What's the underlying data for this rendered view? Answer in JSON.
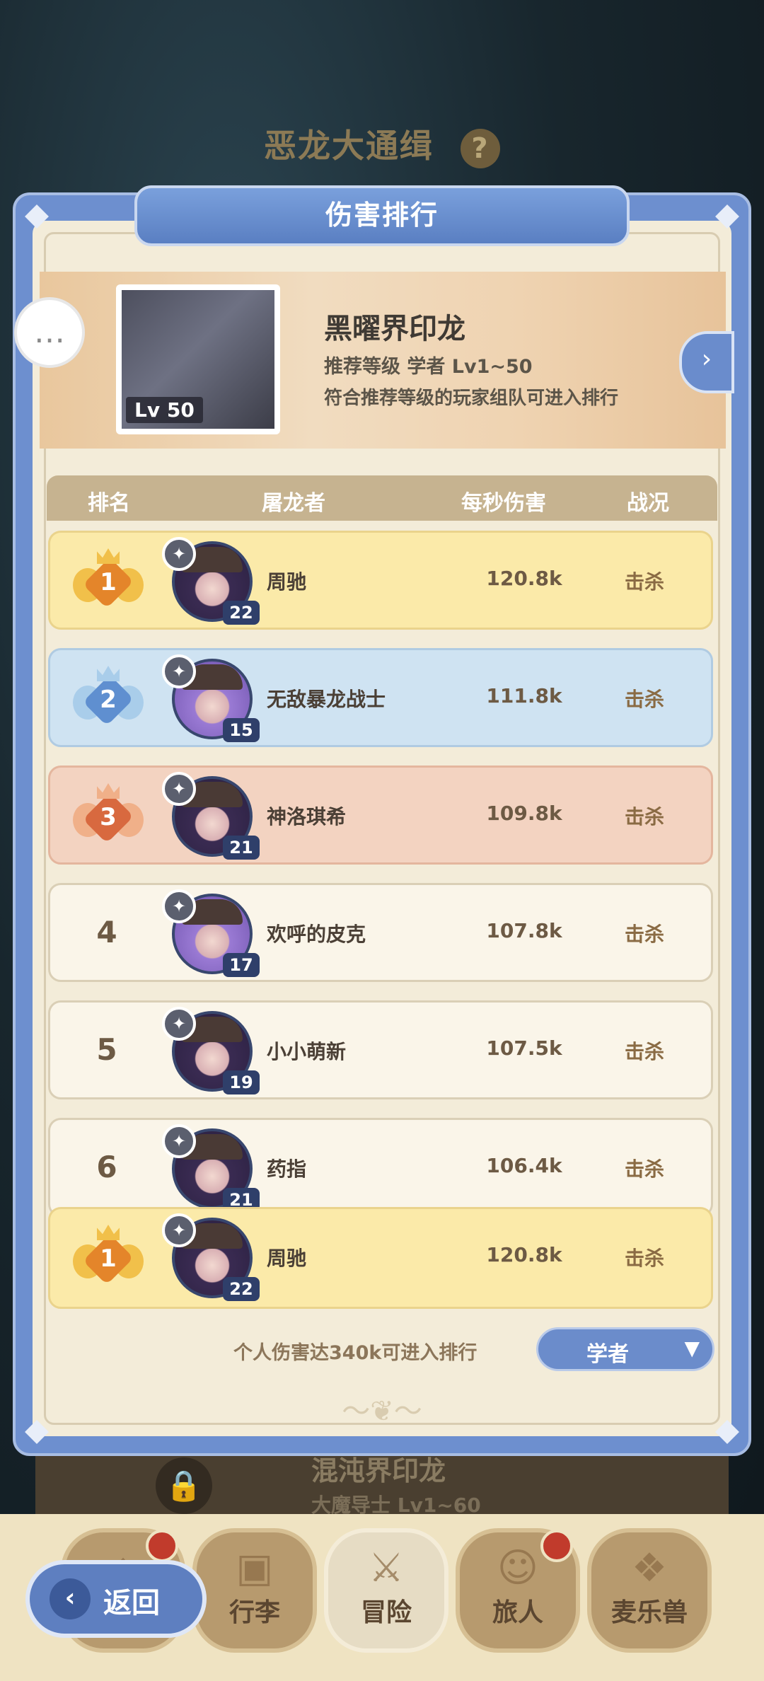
{
  "background": {
    "title": "恶龙大通缉",
    "help": "?",
    "card_title": "混沌界印龙",
    "card_sub": "大魔导士  Lv1~60"
  },
  "modal": {
    "title": "伤害排行",
    "boss": {
      "level": "Lv  50",
      "name": "黑曜界印龙",
      "recommend": "推荐等级  学者  Lv1~50",
      "note": "符合推荐等级的玩家组队可进入排行"
    },
    "headers": {
      "rank": "排名",
      "player": "屠龙者",
      "dps": "每秒伤害",
      "status": "战况"
    },
    "rows": [
      {
        "rank": "1",
        "name": "周驰",
        "level": "22",
        "dps": "120.8k",
        "status": "击杀"
      },
      {
        "rank": "2",
        "name": "无敌暴龙战士",
        "level": "15",
        "dps": "111.8k",
        "status": "击杀"
      },
      {
        "rank": "3",
        "name": "神洛琪希",
        "level": "21",
        "dps": "109.8k",
        "status": "击杀"
      },
      {
        "rank": "4",
        "name": "欢呼的皮克",
        "level": "17",
        "dps": "107.8k",
        "status": "击杀"
      },
      {
        "rank": "5",
        "name": "小小萌新",
        "level": "19",
        "dps": "107.5k",
        "status": "击杀"
      },
      {
        "rank": "6",
        "name": "药指",
        "level": "21",
        "dps": "106.4k",
        "status": "击杀"
      }
    ],
    "my_row": {
      "rank": "1",
      "name": "周驰",
      "level": "22",
      "dps": "120.8k",
      "status": "击杀"
    },
    "footer_note": "个人伤害达340k可进入排行",
    "class_select": "学者",
    "class_arrow": "▼"
  },
  "nav": {
    "back": "返回",
    "items": [
      "行李",
      "冒险",
      "旅人",
      "麦乐兽"
    ]
  },
  "colors": {
    "gold": "#fbeaa9",
    "silver": "#cfe3f2",
    "bronze": "#f3d3c1",
    "accent": "#6b8ccb"
  }
}
